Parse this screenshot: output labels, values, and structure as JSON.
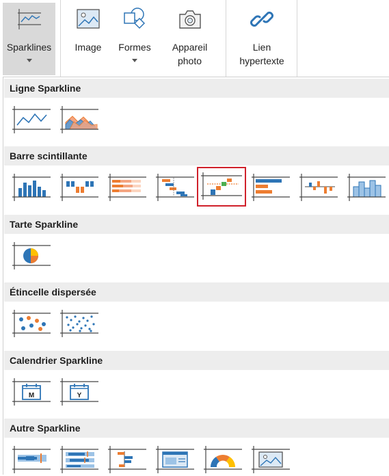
{
  "ribbon": {
    "buttons": [
      {
        "id": "sparklines",
        "label": "Sparklines",
        "has_dropdown": true,
        "active": true
      },
      {
        "id": "image",
        "label": "Image",
        "has_dropdown": false
      },
      {
        "id": "formes",
        "label": "Formes",
        "has_dropdown": true
      },
      {
        "id": "appareil_line1",
        "label": "Appareil"
      },
      {
        "id": "appareil_line2",
        "label": "photo"
      },
      {
        "id": "lien_line1",
        "label": "Lien"
      },
      {
        "id": "lien_line2",
        "label": "hypertexte"
      }
    ],
    "sparklines_label": "Sparklines",
    "image_label": "Image",
    "formes_label": "Formes",
    "appareil_label_1": "Appareil",
    "appareil_label_2": "photo",
    "lien_label_1": "Lien",
    "lien_label_2": "hypertexte"
  },
  "gallery": {
    "sections": [
      {
        "title": "Ligne Sparkline",
        "items": [
          "line-sparkline-icon",
          "area-sparkline-icon"
        ]
      },
      {
        "title": "Barre scintillante",
        "items": [
          "column-sparkline-icon",
          "winloss-sparkline-icon",
          "stacked-bar-sparkline-icon",
          "cascade-sparkline-icon",
          "pareto-sparkline-icon",
          "hbar-sparkline-icon",
          "vari-sparkline-icon",
          "histogram-sparkline-icon"
        ],
        "selected_index": 4
      },
      {
        "title": "Tarte Sparkline",
        "items": [
          "pie-sparkline-icon"
        ]
      },
      {
        "title": "Étincelle dispersée",
        "items": [
          "scatter-sparkline-icon",
          "spread-sparkline-icon"
        ]
      },
      {
        "title": "Calendrier Sparkline",
        "items": [
          "month-sparkline-icon",
          "year-sparkline-icon"
        ]
      },
      {
        "title": "Autre Sparkline",
        "items": [
          "bullet-sparkline-icon",
          "boxplot-sparkline-icon",
          "bar-label-sparkline-icon",
          "image-table-sparkline-icon",
          "gauge-sparkline-icon",
          "image-sparkline-icon"
        ]
      }
    ],
    "month_letter": "M",
    "year_letter": "Y"
  },
  "colors": {
    "blue": "#2e75b6",
    "orange": "#ed7d31",
    "green": "#4caf50",
    "yellow": "#ffc000",
    "selection": "#d0202a",
    "section_header_bg": "#ededed"
  }
}
